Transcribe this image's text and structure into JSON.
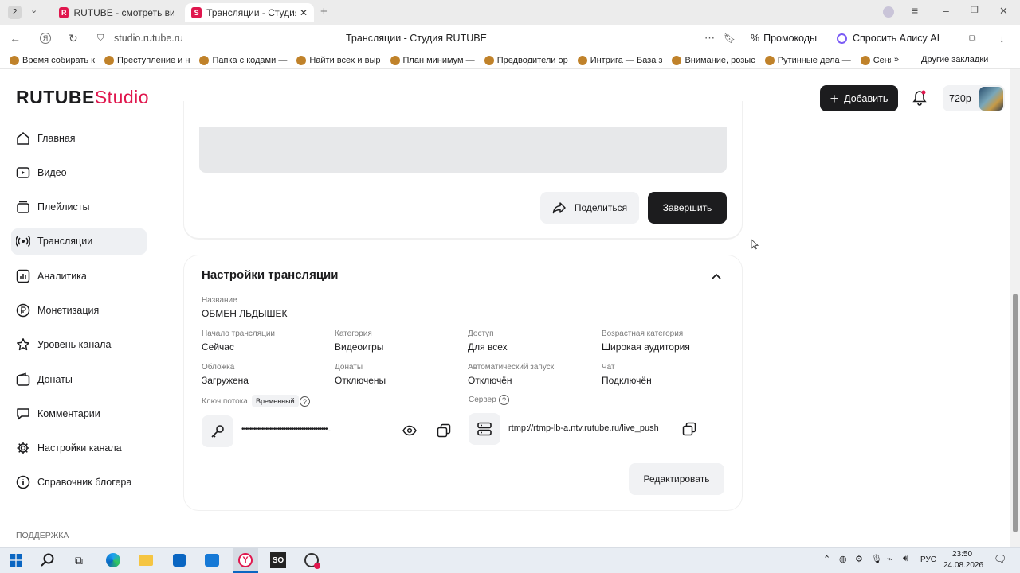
{
  "browser": {
    "tab_counter": "2",
    "tabs": [
      {
        "label": "RUTUBE - смотреть виде",
        "active": false
      },
      {
        "label": "Трансляции - Студия R",
        "active": true
      }
    ],
    "url": "studio.rutube.ru",
    "page_title": "Трансляции - Студия RUTUBE",
    "promo_label": "Промокоды",
    "alice_label": "Спросить Алису AI",
    "bookmarks": [
      "Время собирать к",
      "Преступление и н",
      "Папка с кодами —",
      "Найти всех и выр",
      "План минимум —",
      "Предводители ор",
      "Интрига — База з",
      "Внимание, розыс",
      "Рутинные дела —",
      "Сеня"
    ],
    "other_bookmarks": "Другие закладки"
  },
  "header": {
    "logo_main": "RUTUBE",
    "logo_sub": "Studio",
    "add_label": "Добавить",
    "quality": "720р"
  },
  "sidebar": {
    "items": [
      {
        "label": "Главная",
        "icon": "home-icon"
      },
      {
        "label": "Видео",
        "icon": "video-icon"
      },
      {
        "label": "Плейлисты",
        "icon": "playlist-icon"
      },
      {
        "label": "Трансляции",
        "icon": "broadcast-icon",
        "selected": true
      },
      {
        "label": "Аналитика",
        "icon": "analytics-icon"
      },
      {
        "label": "Монетизация",
        "icon": "ruble-icon"
      },
      {
        "label": "Уровень канала",
        "icon": "star-icon"
      },
      {
        "label": "Донаты",
        "icon": "wallet-icon"
      },
      {
        "label": "Комментарии",
        "icon": "comment-icon"
      },
      {
        "label": "Настройки канала",
        "icon": "gear-icon"
      },
      {
        "label": "Справочник блогера",
        "icon": "info-icon"
      }
    ],
    "support": "ПОДДЕРЖКА"
  },
  "stream": {
    "share_label": "Поделиться",
    "finish_label": "Завершить"
  },
  "settings": {
    "title": "Настройки трансляции",
    "name_label": "Название",
    "name_value": "ОБМЕН ЛЬДЫШЕК",
    "fields": [
      {
        "label": "Начало трансляции",
        "value": "Сейчас"
      },
      {
        "label": "Категория",
        "value": "Видеоигры"
      },
      {
        "label": "Доступ",
        "value": "Для всех"
      },
      {
        "label": "Возрастная категория",
        "value": "Широкая аудитория"
      },
      {
        "label": "Обложка",
        "value": "Загружена"
      },
      {
        "label": "Донаты",
        "value": "Отключены"
      },
      {
        "label": "Автоматический запуск",
        "value": "Отключён"
      },
      {
        "label": "Чат",
        "value": "Подключён"
      }
    ],
    "key_label": "Ключ потока",
    "key_badge": "Временный",
    "key_value": "•••••••••••••••••••••••••••••••••••••••••••...",
    "server_label": "Сервер",
    "server_value": "rtmp://rtmp-lb-a.ntv.rutube.ru/live_push",
    "edit_label": "Редактировать"
  },
  "taskbar": {
    "lang": "РУС",
    "time": "23:50",
    "date": "24.08.2026"
  },
  "colors": {
    "brand": "#e0174e",
    "dark_button": "#1c1c1e"
  }
}
